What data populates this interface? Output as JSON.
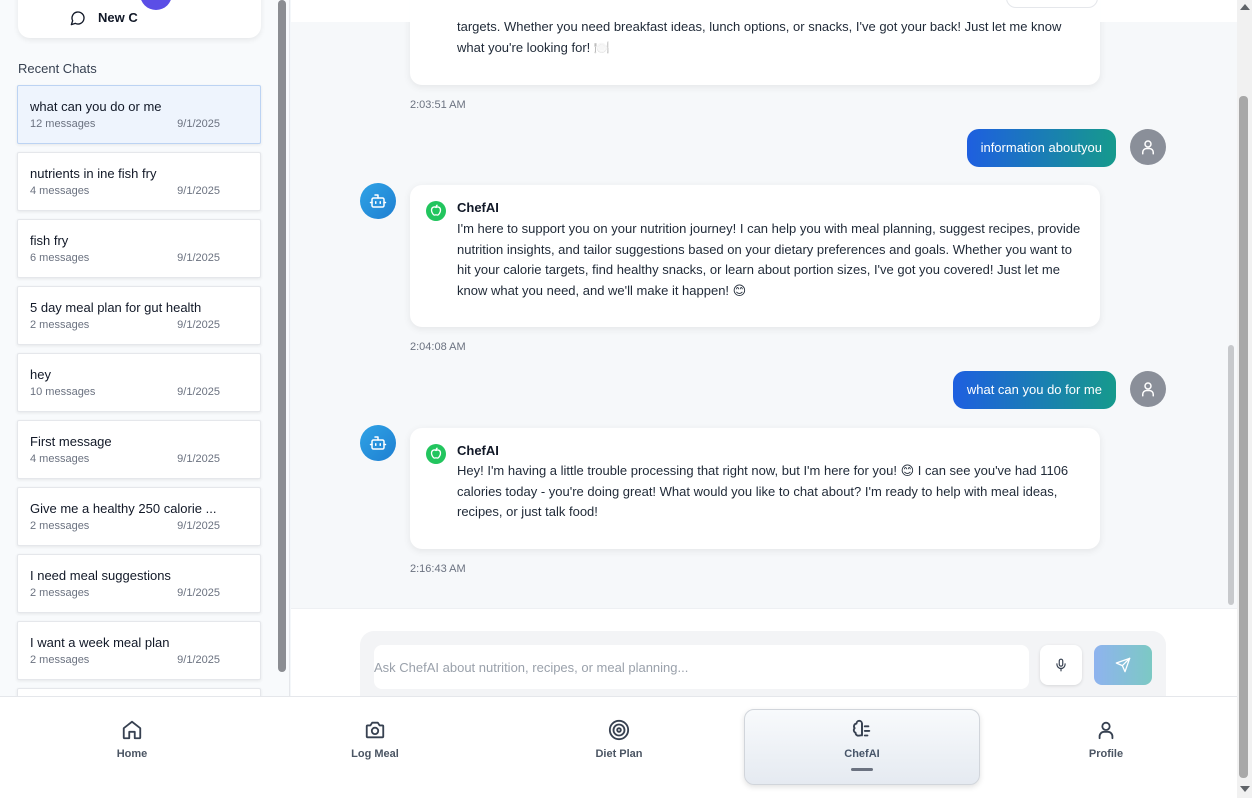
{
  "sidebar": {
    "new_chat_label": "New C",
    "recent_title": "Recent Chats",
    "chats": [
      {
        "title": "what can you do or me",
        "count": "12 messages",
        "date": "9/1/2025"
      },
      {
        "title": "nutrients in ine fish fry",
        "count": "4 messages",
        "date": "9/1/2025"
      },
      {
        "title": "fish fry",
        "count": "6 messages",
        "date": "9/1/2025"
      },
      {
        "title": "5 day meal plan for gut health",
        "count": "2 messages",
        "date": "9/1/2025"
      },
      {
        "title": "hey",
        "count": "10 messages",
        "date": "9/1/2025"
      },
      {
        "title": "First message",
        "count": "4 messages",
        "date": "9/1/2025"
      },
      {
        "title": "Give me a healthy 250 calorie ...",
        "count": "2 messages",
        "date": "9/1/2025"
      },
      {
        "title": "I need meal suggestions",
        "count": "2 messages",
        "date": "9/1/2025"
      },
      {
        "title": "I want a week meal plan",
        "count": "2 messages",
        "date": "9/1/2025"
      }
    ]
  },
  "messages": {
    "m0_text": "targets. Whether you need breakfast ideas, lunch options, or snacks, I've got your back! Just let me know what you're looking for! 🍽️",
    "m0_time": "2:03:51 AM",
    "user1": "information aboutyou",
    "bot_name": "ChefAI",
    "m1_text": "I'm here to support you on your nutrition journey! I can help you with meal planning, suggest recipes, provide nutrition insights, and tailor suggestions based on your dietary preferences and goals. Whether you want to hit your calorie targets, find healthy snacks, or learn about portion sizes, I've got you covered! Just let me know what you need, and we'll make it happen! 😊",
    "m1_time": "2:04:08 AM",
    "user2": "what can you do for me",
    "m2_text": "Hey! I'm having a little trouble processing that right now, but I'm here for you! 😊 I can see you've had 1106 calories today - you're doing great! What would you like to chat about? I'm ready to help with meal ideas, recipes, or just talk food!",
    "m2_time": "2:16:43 AM"
  },
  "composer": {
    "placeholder": "Ask ChefAI about nutrition, recipes, or meal planning...",
    "value": ""
  },
  "nav": {
    "home": "Home",
    "log_meal": "Log Meal",
    "diet_plan": "Diet Plan",
    "chefai": "ChefAI",
    "profile": "Profile",
    "active": "ChefAI"
  },
  "colors": {
    "user_bubble_start": "#1e5fe0",
    "user_bubble_end": "#169a8c",
    "bot_badge": "#22c55e",
    "avatar_bot": "#2fa3e6"
  }
}
